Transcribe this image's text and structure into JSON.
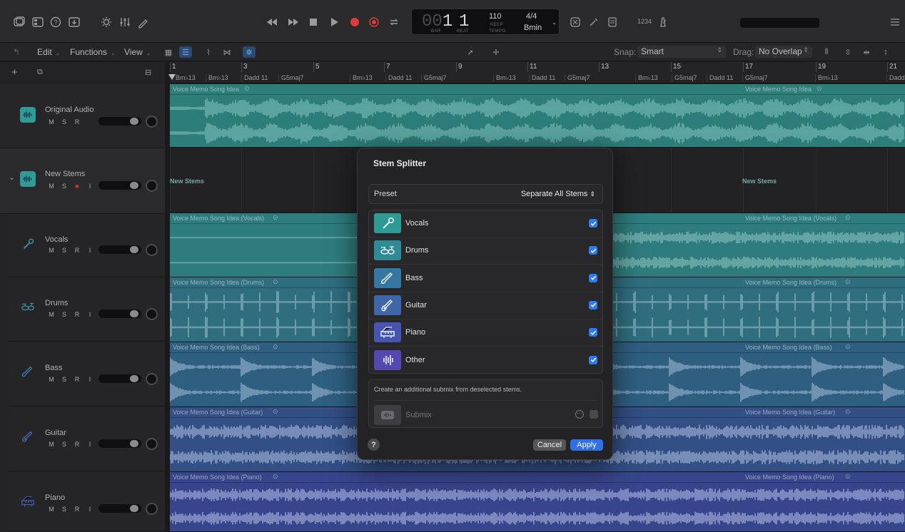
{
  "transport": {
    "bar_value": "00",
    "bar_main": "1",
    "beat_value": "1",
    "bar_label": "BAR",
    "beat_label": "BEAT",
    "tempo_value": "110",
    "tempo_keep": "KEEP",
    "tempo_label": "TEMPO",
    "time_signature": "4/4",
    "key": "Bmin",
    "count_in": "1234"
  },
  "editbar": {
    "edit_label": "Edit",
    "functions_label": "Functions",
    "view_label": "View",
    "snap_label": "Snap:",
    "snap_value": "Smart",
    "drag_label": "Drag:",
    "drag_value": "No Overlap"
  },
  "ruler": {
    "bars": [
      "1",
      "3",
      "5",
      "7",
      "9",
      "11",
      "13",
      "15",
      "17",
      "19",
      "21"
    ],
    "chords": [
      "Bm♭13",
      "Bm♭13",
      "Dadd 11",
      "G5maj7",
      "Bm♭13",
      "Dadd 11",
      "G5maj7",
      "Bm♭13",
      "Dadd 11",
      "G5maj7",
      "Bm♭13",
      "G5maj7",
      "Dadd 11",
      "G5maj7",
      "Bm♭13",
      "Dadd"
    ]
  },
  "tracks": [
    {
      "name": "Original Audio",
      "buttons": [
        "M",
        "S",
        "R"
      ],
      "color": "#2f9a98"
    },
    {
      "name": "New Stems",
      "buttons": [
        "M",
        "S",
        "■",
        "I"
      ],
      "color": "#2f9a98"
    },
    {
      "name": "Vocals",
      "buttons": [
        "M",
        "S",
        "R",
        "I"
      ],
      "color": "#3b8fa0"
    },
    {
      "name": "Drums",
      "buttons": [
        "M",
        "S",
        "R",
        "I"
      ],
      "color": "#3b8fa0"
    },
    {
      "name": "Bass",
      "buttons": [
        "M",
        "S",
        "R",
        "I"
      ],
      "color": "#3f78a8"
    },
    {
      "name": "Guitar",
      "buttons": [
        "M",
        "S",
        "R",
        "I"
      ],
      "color": "#4266ac"
    },
    {
      "name": "Piano",
      "buttons": [
        "M",
        "S",
        "R",
        "I"
      ],
      "color": "#4a55b0"
    }
  ],
  "regions": {
    "original": "Voice Memo Song Idea",
    "new_stems": "New Stems",
    "vocals": "Voice Memo Song Idea (Vocals)",
    "drums": "Voice Memo Song Idea (Drums)",
    "bass": "Voice Memo Song Idea (Bass)",
    "guitar": "Voice Memo Song Idea (Guitar)",
    "piano": "Voice Memo Song Idea (Piano)"
  },
  "dialog": {
    "title": "Stem Splitter",
    "preset_label": "Preset",
    "preset_value": "Separate All Stems",
    "stems": [
      {
        "label": "Vocals",
        "checked": true,
        "color": "#2f9a94",
        "icon": "microphone-icon"
      },
      {
        "label": "Drums",
        "checked": true,
        "color": "#2f8a98",
        "icon": "drum-kit-icon"
      },
      {
        "label": "Bass",
        "checked": true,
        "color": "#3577a0",
        "icon": "bass-guitar-icon"
      },
      {
        "label": "Guitar",
        "checked": true,
        "color": "#3f66a8",
        "icon": "guitar-icon"
      },
      {
        "label": "Piano",
        "checked": true,
        "color": "#4755b0",
        "icon": "piano-icon"
      },
      {
        "label": "Other",
        "checked": true,
        "color": "#5548b0",
        "icon": "waveform-icon"
      }
    ],
    "submix_note": "Create an additional submix from deselected stems.",
    "submix_label": "Submix",
    "help": "?",
    "cancel": "Cancel",
    "apply": "Apply"
  }
}
